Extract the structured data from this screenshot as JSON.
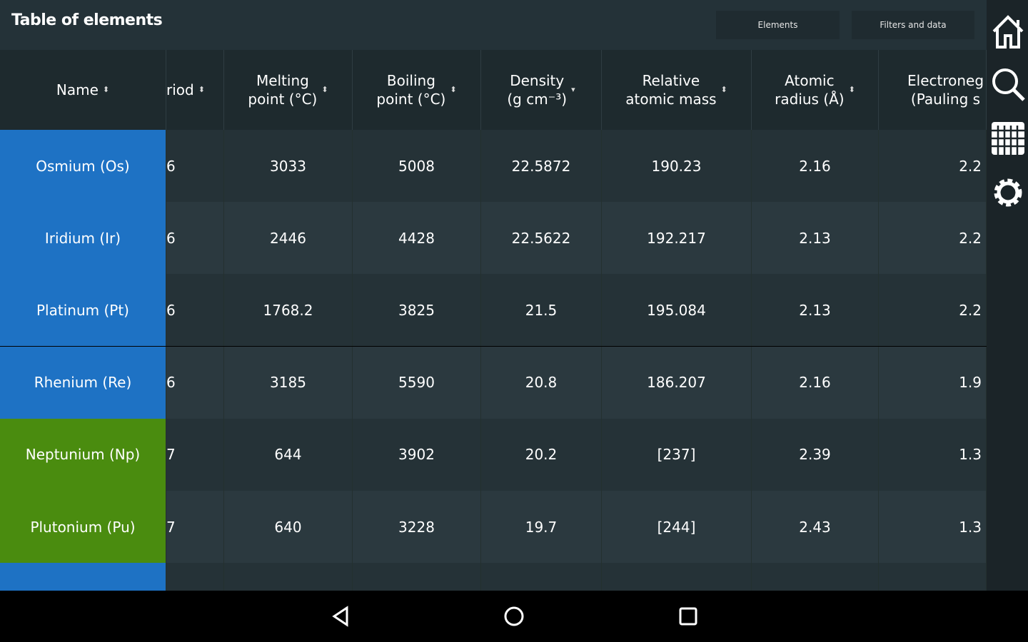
{
  "header": {
    "title": "Table of elements",
    "buttons": [
      "Elements",
      "Filters and data"
    ]
  },
  "rail": [
    "home-icon",
    "search-icon",
    "grid-icon",
    "gear-icon"
  ],
  "columns": [
    "Name",
    "riod",
    "Melting\npoint (°C)",
    "Boiling\npoint (°C)",
    "Density\n(g cm⁻³)",
    "Relative\natomic mass",
    "Atomic\nradius (Å)",
    "Electroneg\n(Pauling s"
  ],
  "rows": [
    {
      "name": "Osmium (Os)",
      "period": "6",
      "melting": "3033",
      "boiling": "5008",
      "density": "22.5872",
      "mass": "190.23",
      "radius": "2.16",
      "en": "2.2",
      "color": "#1e72c4"
    },
    {
      "name": "Iridium (Ir)",
      "period": "6",
      "melting": "2446",
      "boiling": "4428",
      "density": "22.5622",
      "mass": "192.217",
      "radius": "2.13",
      "en": "2.2",
      "color": "#1e72c4"
    },
    {
      "name": "Platinum (Pt)",
      "period": "6",
      "melting": "1768.2",
      "boiling": "3825",
      "density": "21.5",
      "mass": "195.084",
      "radius": "2.13",
      "en": "2.2",
      "color": "#1e72c4"
    },
    {
      "name": "Rhenium (Re)",
      "period": "6",
      "melting": "3185",
      "boiling": "5590",
      "density": "20.8",
      "mass": "186.207",
      "radius": "2.16",
      "en": "1.9",
      "color": "#1e72c4"
    },
    {
      "name": "Neptunium (Np)",
      "period": "7",
      "melting": "644",
      "boiling": "3902",
      "density": "20.2",
      "mass": "[237]",
      "radius": "2.39",
      "en": "1.3",
      "color": "#4a8c0f"
    },
    {
      "name": "Plutonium (Pu)",
      "period": "7",
      "melting": "640",
      "boiling": "3228",
      "density": "19.7",
      "mass": "[244]",
      "radius": "2.43",
      "en": "1.3",
      "color": "#4a8c0f"
    },
    {
      "name": "",
      "period": "",
      "melting": "",
      "boiling": "",
      "density": "",
      "mass": "",
      "radius": "",
      "en": "",
      "color": "#1e72c4"
    }
  ],
  "navbar": [
    "back",
    "home",
    "recents"
  ]
}
